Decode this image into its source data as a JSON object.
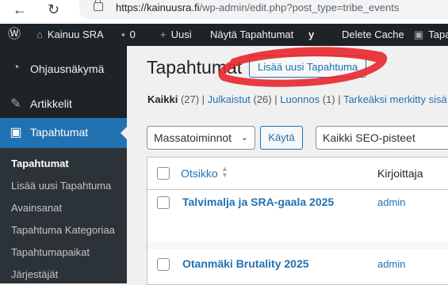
{
  "browser": {
    "url_host": "https://kainuusra.fi",
    "url_path": "/wp-admin/edit.php?post_type=tribe_events"
  },
  "adminbar": {
    "site_name": "Kainuu SRA",
    "comments_count": "0",
    "new_label": "Uusi",
    "view_label": "Näytä Tapahtumat",
    "delete_cache": "Delete Cache",
    "cut_label": "Tapa"
  },
  "sidebar": {
    "items": [
      {
        "label": "Ohjausnäkymä",
        "icon": "dashboard-icon"
      },
      {
        "label": "Artikkelit",
        "icon": "pushpin-icon"
      },
      {
        "label": "Tapahtumat",
        "icon": "calendar-icon"
      }
    ],
    "submenu": [
      "Tapahtumat",
      "Lisää uusi Tapahtuma",
      "Avainsanat",
      "Tapahtuma Kategoriaa",
      "Tapahtumapaikat",
      "Järjestäjät"
    ]
  },
  "main": {
    "title": "Tapahtumat",
    "add_new": "Lisää uusi Tapahtuma",
    "filters": {
      "all": "Kaikki",
      "all_count": "(27)",
      "published": "Julkaistut",
      "published_count": "(26)",
      "drafts": "Luonnos",
      "drafts_count": "(1)",
      "more": "Tarkeäksi merkitty sisä"
    },
    "bulk_select": "Massatoiminnot",
    "apply": "Käytä",
    "seo_select": "Kaikki SEO-pisteet",
    "columns": {
      "title": "Otsikko",
      "author": "Kirjoittaja"
    },
    "rows": [
      {
        "title": "Talvimalja ja SRA-gaala 2025",
        "author": "admin"
      },
      {
        "title": "Otanmäki Brutality 2025",
        "author": "admin"
      }
    ]
  },
  "colors": {
    "accent": "#2271b1",
    "adminbar": "#1d2327",
    "annotation": "#e8262b"
  }
}
